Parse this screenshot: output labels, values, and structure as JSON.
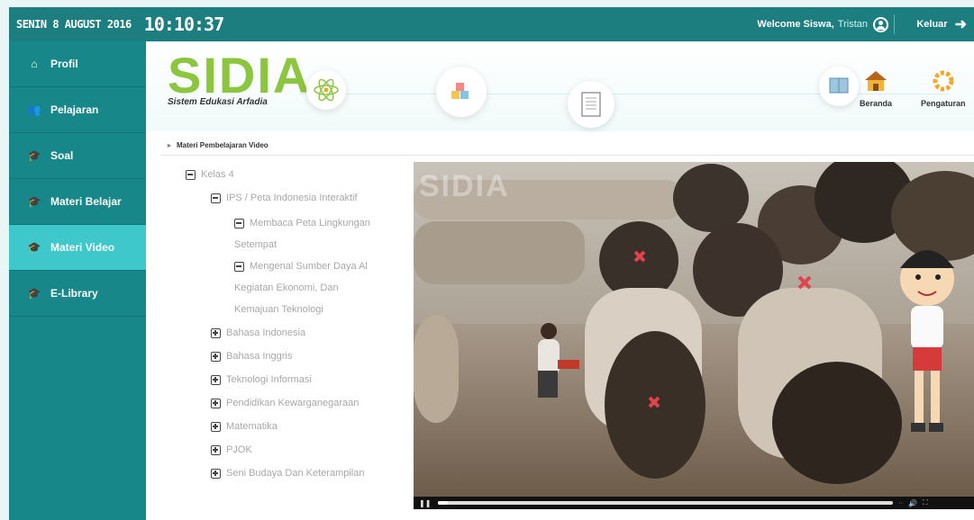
{
  "topbar": {
    "date": "SENIN 8 AUGUST 2016",
    "clock": "10:10:37",
    "welcome": "Welcome Siswa,",
    "user": "Tristan",
    "logout": "Keluar"
  },
  "sidebar": {
    "items": [
      {
        "label": "Profil",
        "icon": "home-icon"
      },
      {
        "label": "Pelajaran",
        "icon": "users-icon"
      },
      {
        "label": "Soal",
        "icon": "graduation-cap-icon"
      },
      {
        "label": "Materi Belajar",
        "icon": "graduation-cap-icon"
      },
      {
        "label": "Materi Video",
        "icon": "graduation-cap-icon",
        "active": true
      },
      {
        "label": "E-Library",
        "icon": "graduation-cap-icon"
      }
    ]
  },
  "header": {
    "logo": "SIDIA",
    "tagline": "Sistem Edukasi Arfadia",
    "nav": [
      {
        "label": "Beranda",
        "icon": "house-icon"
      },
      {
        "label": "Pengaturan",
        "icon": "gear-icon"
      }
    ]
  },
  "breadcrumb": "Materi Pembelajaran Video",
  "tree": {
    "root": "Kelas 4",
    "subject": "IPS / Peta Indonesia Interaktif",
    "topic1_line1": "Membaca Peta Lingkungan",
    "topic1_line2": "Setempat",
    "topic2_line1": "Mengenal Sumber Daya Al",
    "topic2_line2": "Kegiatan Ekonomi, Dan",
    "topic2_line3": "Kemajuan Teknologi",
    "others": [
      "Bahasa Indonesia",
      "Bahasa Inggris",
      "Teknologi Informasi",
      "Pendidikan Kewarganegaraan",
      "Matematika",
      "PJOK",
      "Seni Budaya Dan Keterampilan"
    ]
  },
  "video": {
    "watermark": "SIDIA",
    "progress": 0.02
  }
}
